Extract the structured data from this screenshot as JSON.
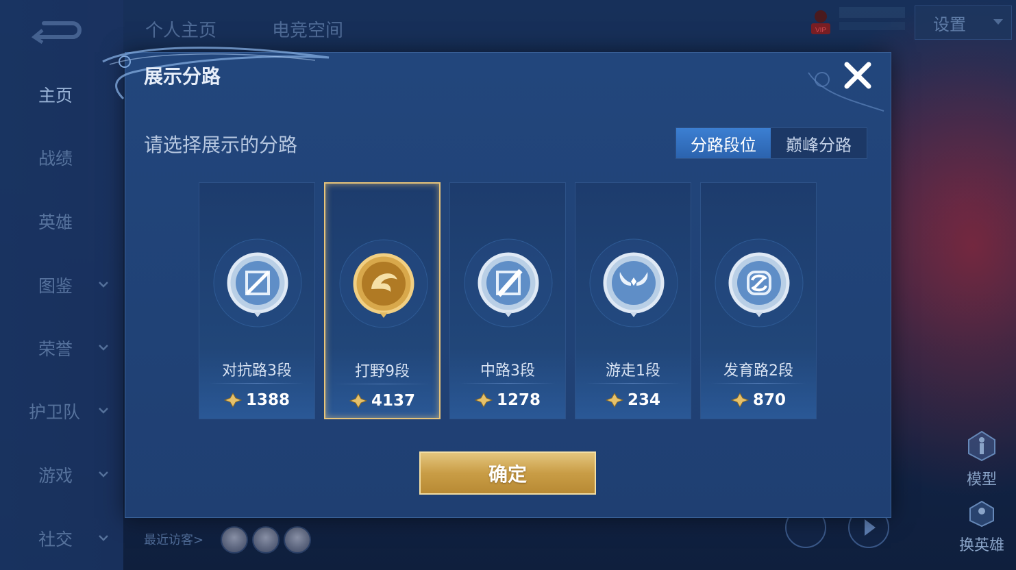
{
  "sidebar": {
    "items": [
      {
        "label": "主页",
        "active": true,
        "has_chevron": false
      },
      {
        "label": "战绩",
        "active": false,
        "has_chevron": false
      },
      {
        "label": "英雄",
        "active": false,
        "has_chevron": false
      },
      {
        "label": "图鉴",
        "active": false,
        "has_chevron": true
      },
      {
        "label": "荣誉",
        "active": false,
        "has_chevron": true
      },
      {
        "label": "护卫队",
        "active": false,
        "has_chevron": true
      },
      {
        "label": "游戏",
        "active": false,
        "has_chevron": true
      },
      {
        "label": "社交",
        "active": false,
        "has_chevron": true
      }
    ]
  },
  "header": {
    "tabs": [
      "个人主页",
      "电竞空间"
    ],
    "settings_label": "设置",
    "vip_label": "VIP"
  },
  "right_panel": {
    "model_label": "模型",
    "switch_hero_label": "换英雄"
  },
  "footer": {
    "visitors_label": "最近访客>"
  },
  "modal": {
    "title": "展示分路",
    "subtitle": "请选择展示的分路",
    "tabs": {
      "active": "分路段位",
      "inactive": "巅峰分路"
    },
    "confirm_label": "确定",
    "cards": [
      {
        "name": "对抗路3段",
        "score": "1388",
        "emblem": "sword-emblem-icon",
        "selected": false
      },
      {
        "name": "打野9段",
        "score": "4137",
        "emblem": "dragon-emblem-icon",
        "selected": true
      },
      {
        "name": "中路3段",
        "score": "1278",
        "emblem": "slash-emblem-icon",
        "selected": false
      },
      {
        "name": "游走1段",
        "score": "234",
        "emblem": "wing-emblem-icon",
        "selected": false
      },
      {
        "name": "发育路2段",
        "score": "870",
        "emblem": "bow-emblem-icon",
        "selected": false
      }
    ]
  },
  "colors": {
    "gold": "#e7c47a",
    "blue_tab": "#3c7fd2",
    "panel": "#22467c"
  }
}
